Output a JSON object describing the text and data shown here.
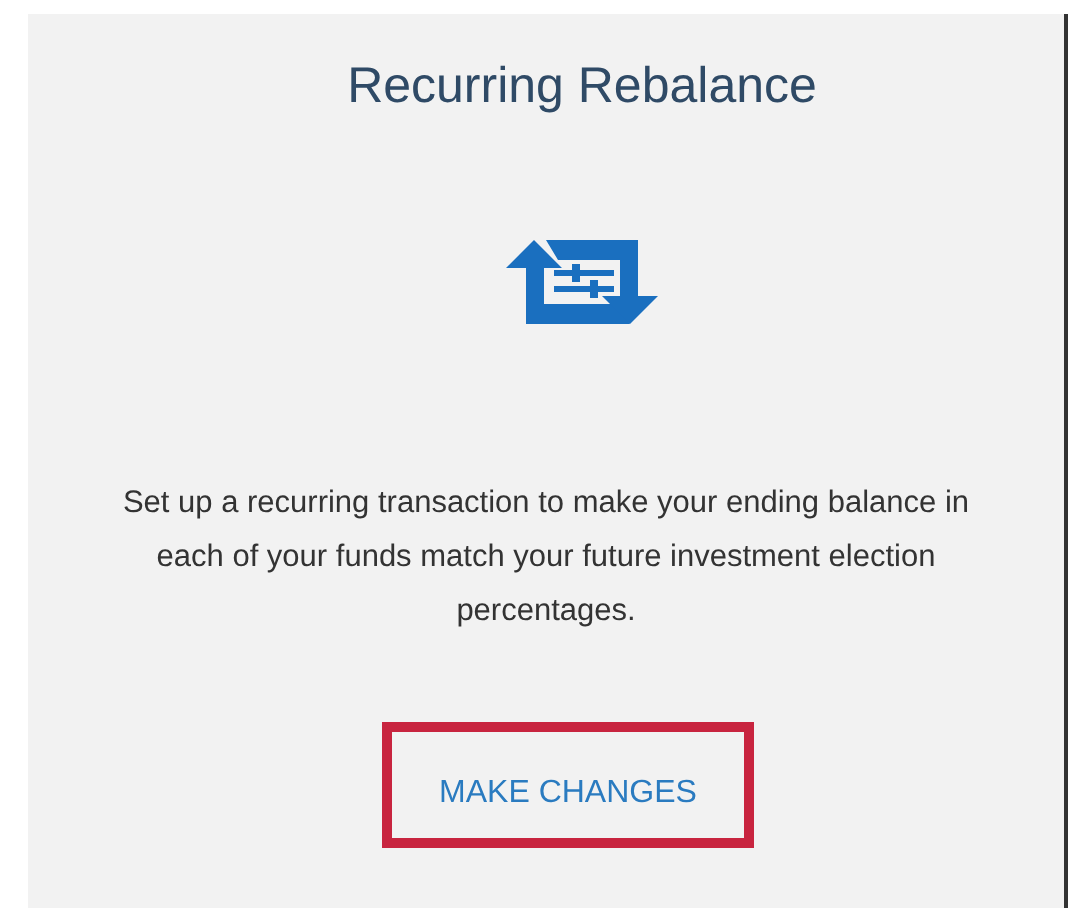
{
  "card": {
    "title": "Recurring Rebalance",
    "description": "Set up a recurring transaction to make your ending balance in each of your funds match your future investment election percentages.",
    "button": {
      "label": "MAKE CHANGES"
    }
  }
}
